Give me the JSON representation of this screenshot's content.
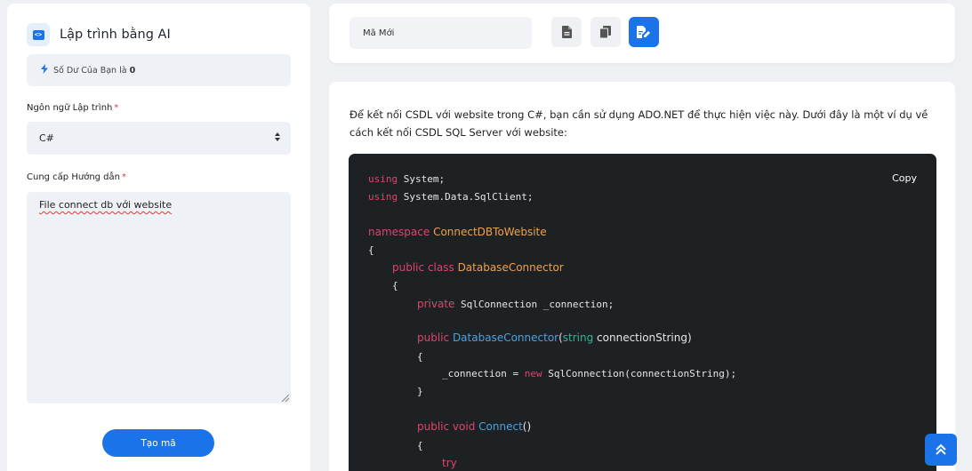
{
  "sidebar": {
    "title": "Lập trình bằng AI",
    "balance_text": "Số Dư Của Bạn là",
    "balance_value": "0",
    "language_label": "Ngôn ngữ Lập trình",
    "language_value": "C#",
    "guide_label": "Cung cấp Hướng dẫn",
    "guide_value": "File connect db với website",
    "generate_button": "Tạo mã",
    "required_mark": "*"
  },
  "toolbar": {
    "new_code_value": "Mã Mới"
  },
  "content": {
    "intro": "Để kết nối CSDL với website trong C#, bạn cần sử dụng ADO.NET để thực hiện việc này. Dưới đây là một ví dụ về cách kết nối CSDL SQL Server với website:",
    "copy_label": "Copy",
    "code": {
      "l1_kw": "using",
      "l1_rest": " System;",
      "l2_kw": "using",
      "l2_rest": " System.Data.SqlClient;",
      "l3_kw": "namespace",
      "l3_name": "ConnectDBToWebsite",
      "l4": "{",
      "l5_kw1": "public",
      "l5_kw2": "class",
      "l5_name": "DatabaseConnector",
      "l6": "{",
      "l7_kw": "private",
      "l7_rest": " SqlConnection _connection;",
      "l8_kw": "public",
      "l8_fn": "DatabaseConnector",
      "l8_open": "(",
      "l8_type": "string",
      "l8_param": " connectionString)",
      "l9": "{",
      "l10_pre": "_connection = ",
      "l10_kw": "new",
      "l10_rest": " SqlConnection(connectionString);",
      "l11": "}",
      "l12_kw": "public void",
      "l12_fn": "Connect",
      "l12_paren": "()",
      "l13": "{",
      "l14_kw": "try"
    }
  },
  "colors": {
    "accent": "#1a73e8",
    "keyword": "#e0436b",
    "class_name": "#f0a14a",
    "function": "#4aa3df",
    "type": "#2fb59a",
    "required": "#e53935"
  },
  "icons": {
    "brand": "code-icon",
    "balance": "bolt-icon",
    "doc": "document-icon",
    "copy": "copy-icon",
    "edit": "edit-icon",
    "scroll": "double-chevron-up-icon"
  }
}
